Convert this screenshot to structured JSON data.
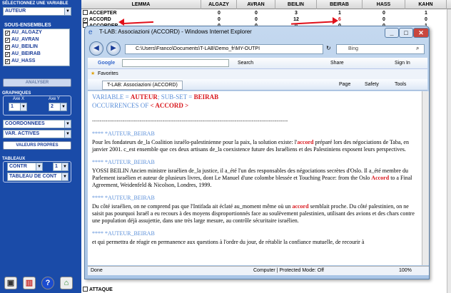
{
  "left_panel": {
    "select_variable_label": "SÉLECTIONNEZ UNE VARIABLE",
    "variable_value": "AUTEUR",
    "subsets_label": "SOUS-ENSEMBLES",
    "subsets": [
      "AU_ALGAZY",
      "AU_AVRAN",
      "AU_BEILIN",
      "AU_BEIRAB",
      "AU_HASS"
    ],
    "analyze_button": "ANALYSER",
    "graphs_label": "GRAPHIQUES",
    "axis_x_label": "Axe X",
    "axis_y_label": "Axe Y",
    "axis_x_value": "1",
    "axis_y_value": "2",
    "coordinates_value": "COORDONNEES",
    "active_vars_value": "VAR. ACTIVES",
    "eigenvalues_button": "VALEURS PROPRES",
    "tables_label": "TABLEAUX",
    "table_type_value": "CONTR",
    "table_num_value": "1",
    "table_cont_value": "TABLEAU DE CONT"
  },
  "grid": {
    "headers": [
      "LEMMA",
      "ALGAZY",
      "AVRAN",
      "BEILIN",
      "BEIRAB",
      "HASS",
      "KAHN"
    ],
    "rows": [
      {
        "lemma": "ACCEPTER",
        "checked": false,
        "values": [
          "0",
          "0",
          "3",
          "1",
          "0",
          "1"
        ]
      },
      {
        "lemma": "ACCORD",
        "checked": true,
        "values": [
          "0",
          "0",
          "12",
          "6",
          "0",
          "0"
        ]
      },
      {
        "lemma": "ACCORDER",
        "checked": false,
        "values": [
          "0",
          "0",
          "0",
          "0",
          "0",
          "1"
        ]
      }
    ],
    "bottom_row_lemma": "ATTAQUE",
    "highlight_color": "#d8161c"
  },
  "ie": {
    "title": "T-LAB: Associazioni (ACCORD) - Windows Internet Explorer",
    "address": "C:\\Users\\Franco\\Documents\\T-LAB\\Demo_fr\\MY-OUTPI",
    "search_engine": "Bing",
    "google_label": "Google",
    "search_btn": "Search",
    "share_btn": "Share",
    "sign_in": "Sign In",
    "favorites": "Favorites",
    "tab_title": "T-LAB: Associazioni (ACCORD)",
    "page_menu": "Page",
    "safety_menu": "Safety",
    "tools_menu": "Tools",
    "status_left": "Done",
    "status_zone": "Computer | Protected Mode: Off",
    "zoom": "100%"
  },
  "content": {
    "var_prefix": "VARIABLE = ",
    "var_value": "AUTEUR",
    "subset_prefix": "; SUB-SET = ",
    "subset_value": "BEIRAB",
    "occ_prefix": "OCCURRENCES OF ",
    "occ_value": "< ACCORD >",
    "separator": "-------------------------------------------------------------------------------------------------------",
    "sections": [
      {
        "head": "**** *AUTEUR_BEIRAB",
        "pre": "Pour les fondateurs de_la Coalition israélo-palestinienne pour la paix, la solution existe: l'",
        "kw": "accord",
        "post": " préparé lors des négociations de Taba, en janvier 2001. c_est ensemble que ces deux artisans de_la coexistence future des Israéliens et des Palestiniens exposent leurs perspectives."
      },
      {
        "head": "**** *AUTEUR_BEIRAB",
        "pre": "YOSSI BEILIN Ancien ministre israélien de_la justice, il a_été l'un des responsables des négociations secrètes d'Oslo. Il a_été membre du Parlement israélien et auteur de plusieurs livres, dont Le Manuel d'une colombe blessée et Touching Peace: from the Oslo ",
        "kw": "Accord",
        "post": " to a Final Agreement, Weidenfeld & Nicolson, Londres, 1999."
      },
      {
        "head": "**** *AUTEUR_BEIRAB",
        "pre": "Du côté israélien, on ne comprend pas que l'Intifada ait éclaté au_moment même où un ",
        "kw": "accord",
        "post": " semblait proche. Du côté palestinien, on ne saisit pas pourquoi Israël a eu recours à des moyens disproportionnés face au soulèvement palestinien, utilisant des avions et des chars contre une population déjà assujettie, dans une très large mesure, au contrôle sécuritaire israélien."
      },
      {
        "head": "**** *AUTEUR_BEIRAB",
        "pre": "et qui permettra de réagir en permanence aux questions à l'ordre du jour, de rétablir la confiance mutuelle, de recourir à",
        "kw": "",
        "post": ""
      }
    ]
  }
}
